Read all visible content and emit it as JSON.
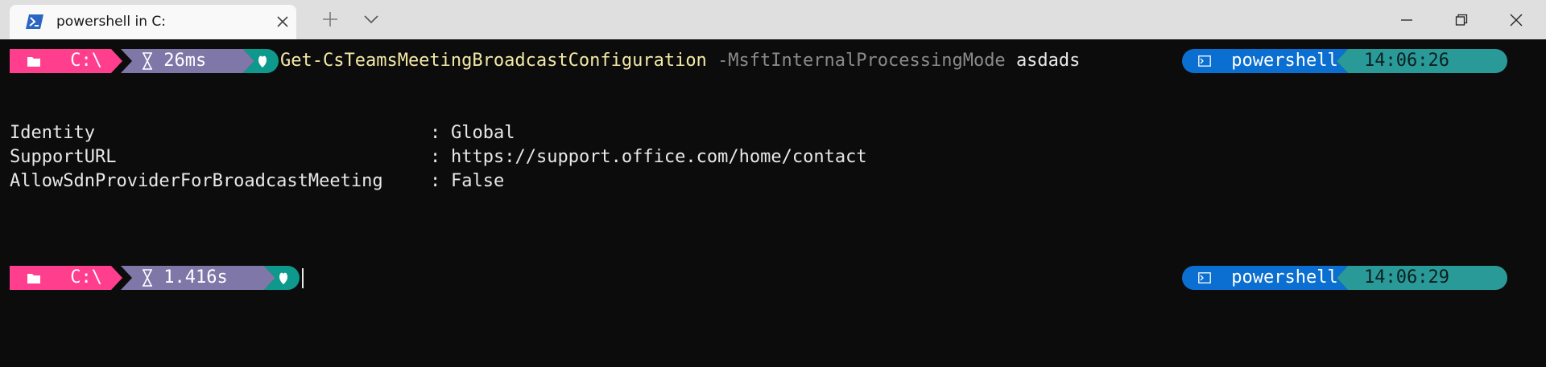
{
  "tab": {
    "title": "powershell in C:",
    "icon": "powershell-icon"
  },
  "window_controls": {
    "new_tab": "plus-icon",
    "dropdown": "chevron-down-icon",
    "minimize": "minimize-icon",
    "maximize": "restore-icon",
    "close": "close-icon"
  },
  "prompts": [
    {
      "path": "C:\\",
      "duration": "26ms",
      "command": "Get-CsTeamsMeetingBroadcastConfiguration",
      "parameter": "-MsftInternalProcessingMode",
      "argument": "asdads",
      "shell": "powershell",
      "clock": "14:06:26"
    },
    {
      "path": "C:\\",
      "duration": "1.416s",
      "command": "",
      "parameter": "",
      "argument": "",
      "shell": "powershell",
      "clock": "14:06:29"
    }
  ],
  "output": [
    {
      "key": "Identity",
      "sep": ":",
      "value": "Global"
    },
    {
      "key": "SupportURL",
      "sep": ":",
      "value": "https://support.office.com/home/contact"
    },
    {
      "key": "AllowSdnProviderForBroadcastMeeting",
      "sep": ":",
      "value": "False"
    }
  ],
  "colors": {
    "path_segment": "#ff3f8e",
    "time_segment": "#7f77a8",
    "status_segment": "#0d9a8c",
    "shell_segment": "#0b6fd1",
    "clock_segment": "#2a9a98",
    "command_name": "#f4e9a6",
    "command_param": "#8a8a8a",
    "terminal_bg": "#0c0c0c",
    "titlebar_bg": "#dfdfdf"
  }
}
